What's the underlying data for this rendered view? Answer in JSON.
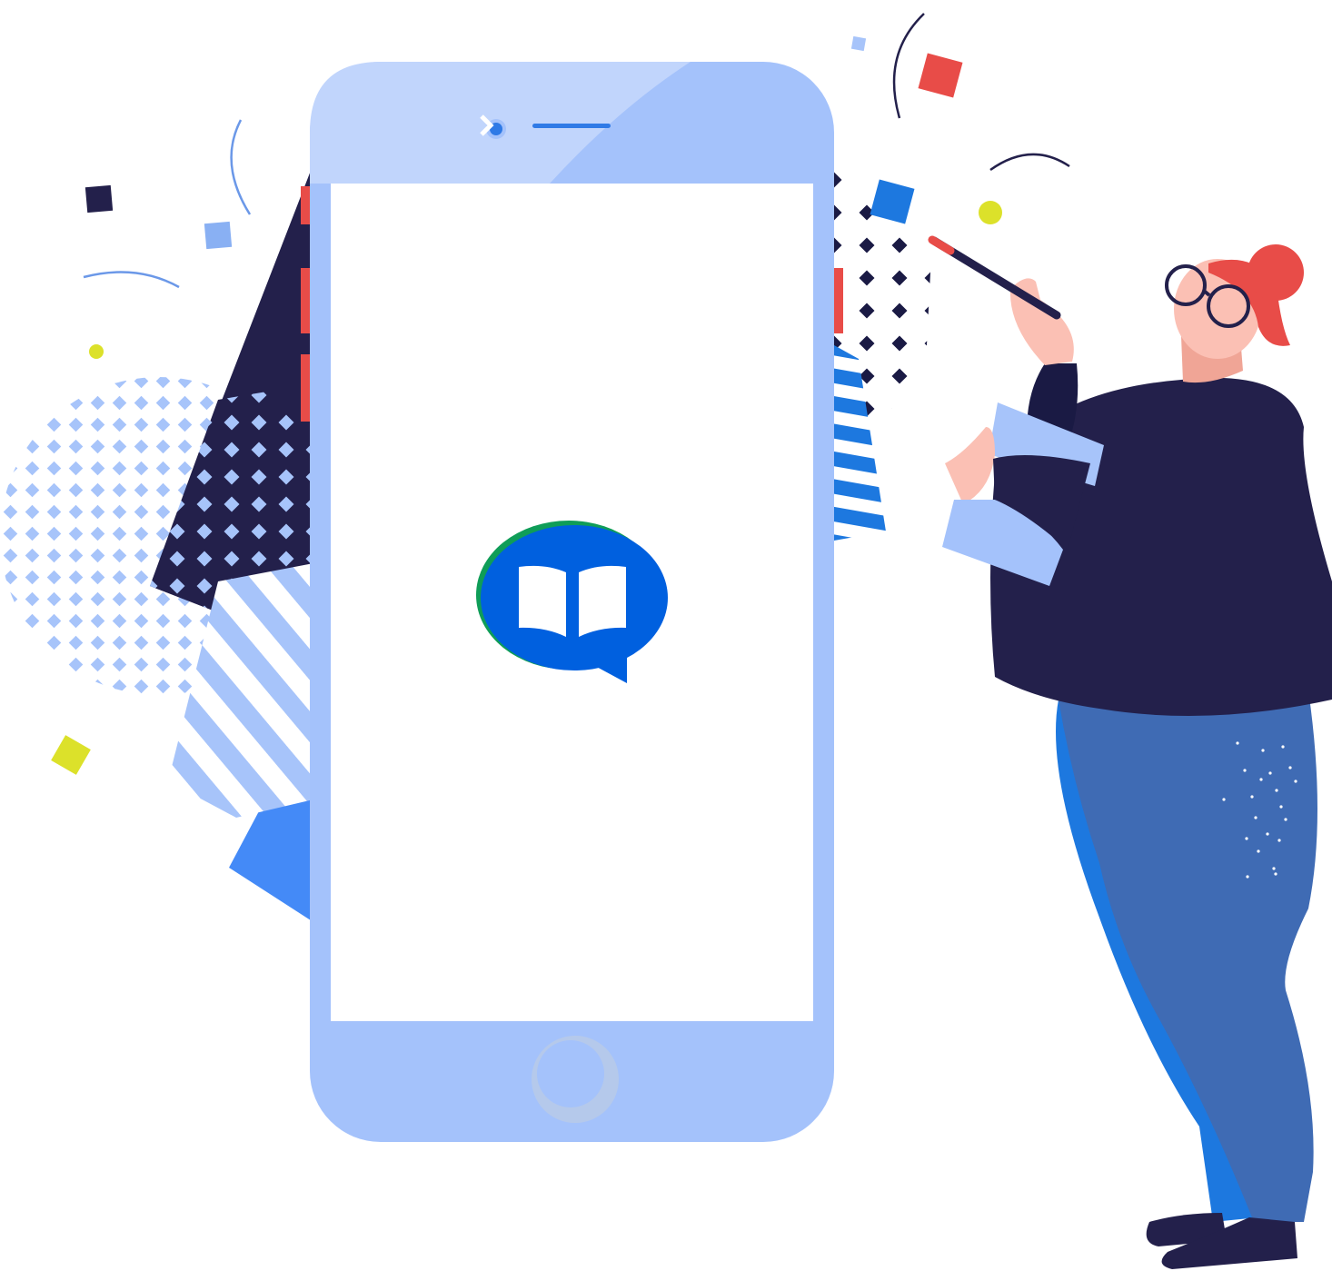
{
  "illustration": {
    "subject": "smartphone-app-launch",
    "app_icon": "open-book-in-speech-bubble-icon",
    "character": "woman-with-pencil-and-clipboard"
  },
  "palette": {
    "phone_body": "#a4c2fb",
    "phone_top": "#c1d5fc",
    "screen": "#ffffff",
    "logo_blue": "#0060df",
    "logo_green": "#0f9d58",
    "navy": "#23204b",
    "pattern_light": "#a7c4fa",
    "accent_blue": "#1d78df",
    "accent_red": "#e84c48",
    "accent_yellow": "#dce12a",
    "skin": "#fbc0b4",
    "jeans": "#3f6bb4",
    "hair": "#e84c48"
  }
}
